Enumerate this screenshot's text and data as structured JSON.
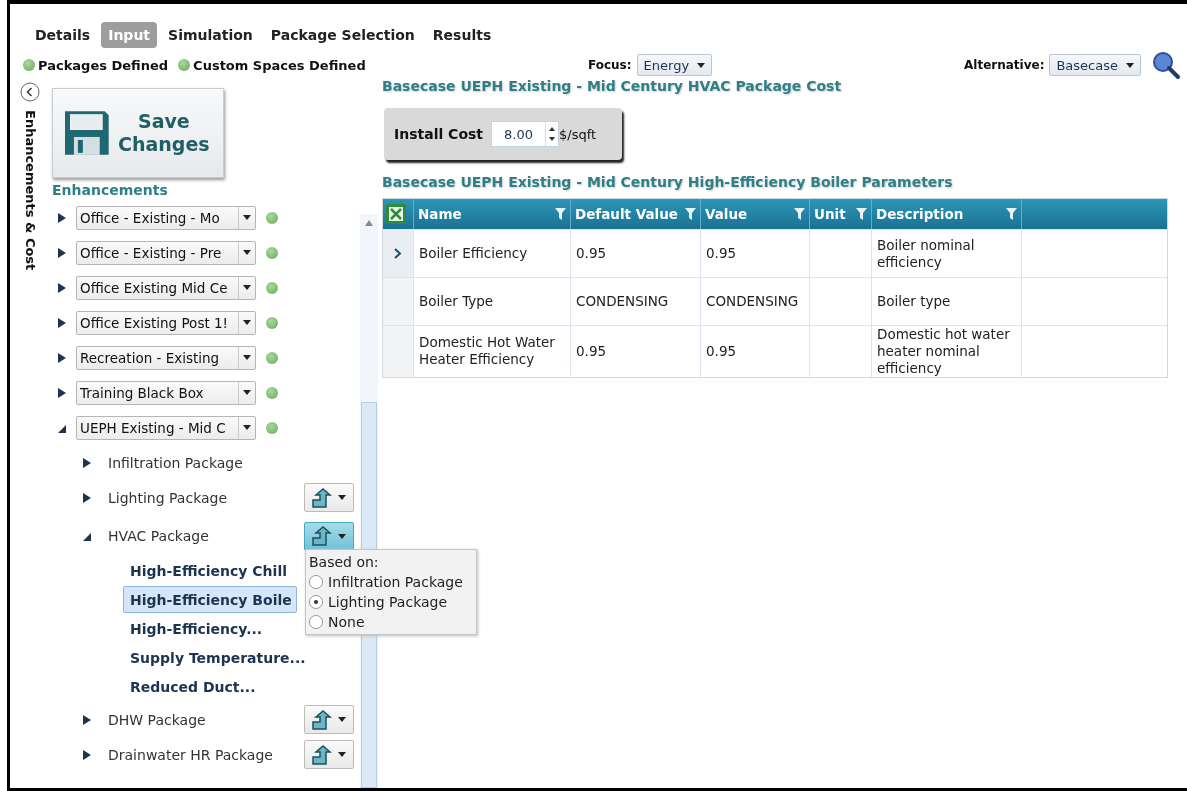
{
  "tabs": [
    {
      "label": "Details",
      "selected": false
    },
    {
      "label": "Input",
      "selected": true
    },
    {
      "label": "Simulation",
      "selected": false
    },
    {
      "label": "Package Selection",
      "selected": false
    },
    {
      "label": "Results",
      "selected": false
    }
  ],
  "indicators": [
    {
      "label": "Packages Defined",
      "defined": true
    },
    {
      "label": "Custom Spaces Defined",
      "defined": true
    }
  ],
  "focus": {
    "label": "Focus:",
    "value": "Energy"
  },
  "alternative": {
    "label": "Alternative:",
    "value": "Basecase"
  },
  "side_tab": {
    "label": "Enhancements & Cost"
  },
  "save_button": {
    "label": "Save Changes"
  },
  "enhancements": {
    "title": "Enhancements",
    "buildings": [
      {
        "name": "Office - Existing - Mo",
        "expanded": false,
        "defined": true
      },
      {
        "name": "Office - Existing - Pre",
        "expanded": false,
        "defined": true
      },
      {
        "name": "Office Existing Mid Ce",
        "expanded": false,
        "defined": true
      },
      {
        "name": "Office Existing Post 1!",
        "expanded": false,
        "defined": true
      },
      {
        "name": "Recreation - Existing",
        "expanded": false,
        "defined": true
      },
      {
        "name": "Training Black Box",
        "expanded": false,
        "defined": true
      },
      {
        "name": "UEPH Existing - Mid C",
        "expanded": true,
        "defined": true,
        "packages": [
          {
            "name": "Infiltration Package",
            "expanded": false,
            "has_menu": false
          },
          {
            "name": "Lighting Package",
            "expanded": false,
            "has_menu": true,
            "menu_open": false
          },
          {
            "name": "HVAC Package",
            "expanded": true,
            "has_menu": true,
            "menu_open": true,
            "measures": [
              {
                "name": "High-Efficiency Chill",
                "selected": false
              },
              {
                "name": "High-Efficiency Boile",
                "selected": true
              },
              {
                "name": "High-Efficiency...",
                "selected": false
              },
              {
                "name": "Supply Temperature...",
                "selected": false
              },
              {
                "name": "Reduced Duct...",
                "selected": false
              }
            ]
          },
          {
            "name": "DHW Package",
            "expanded": false,
            "has_menu": true,
            "menu_open": false
          },
          {
            "name": "Drainwater HR Package",
            "expanded": false,
            "has_menu": true,
            "menu_open": false
          }
        ]
      }
    ]
  },
  "based_on_menu": {
    "title": "Based on:",
    "options": [
      {
        "label": "Infiltration Package",
        "selected": false
      },
      {
        "label": "Lighting Package",
        "selected": true
      },
      {
        "label": "None",
        "selected": false
      }
    ]
  },
  "cost_title": "Basecase UEPH Existing - Mid Century HVAC Package Cost",
  "install_cost": {
    "label": "Install Cost",
    "value": "8.00",
    "unit": "$/sqft"
  },
  "parameters_title": "Basecase UEPH Existing - Mid Century High-Efficiency Boiler Parameters",
  "table": {
    "columns": [
      "Name",
      "Default Value",
      "Value",
      "Unit",
      "Description"
    ],
    "rows": [
      {
        "current": true,
        "cells": [
          "Boiler Efficiency",
          "0.95",
          "0.95",
          "",
          "Boiler nominal efficiency"
        ]
      },
      {
        "current": false,
        "cells": [
          "Boiler Type",
          "CONDENSING",
          "CONDENSING",
          "",
          "Boiler type"
        ]
      },
      {
        "current": false,
        "cells": [
          "Domestic Hot Water Heater Efficiency",
          "0.95",
          "0.95",
          "",
          "Domestic hot water heater nominal efficiency"
        ]
      }
    ]
  }
}
